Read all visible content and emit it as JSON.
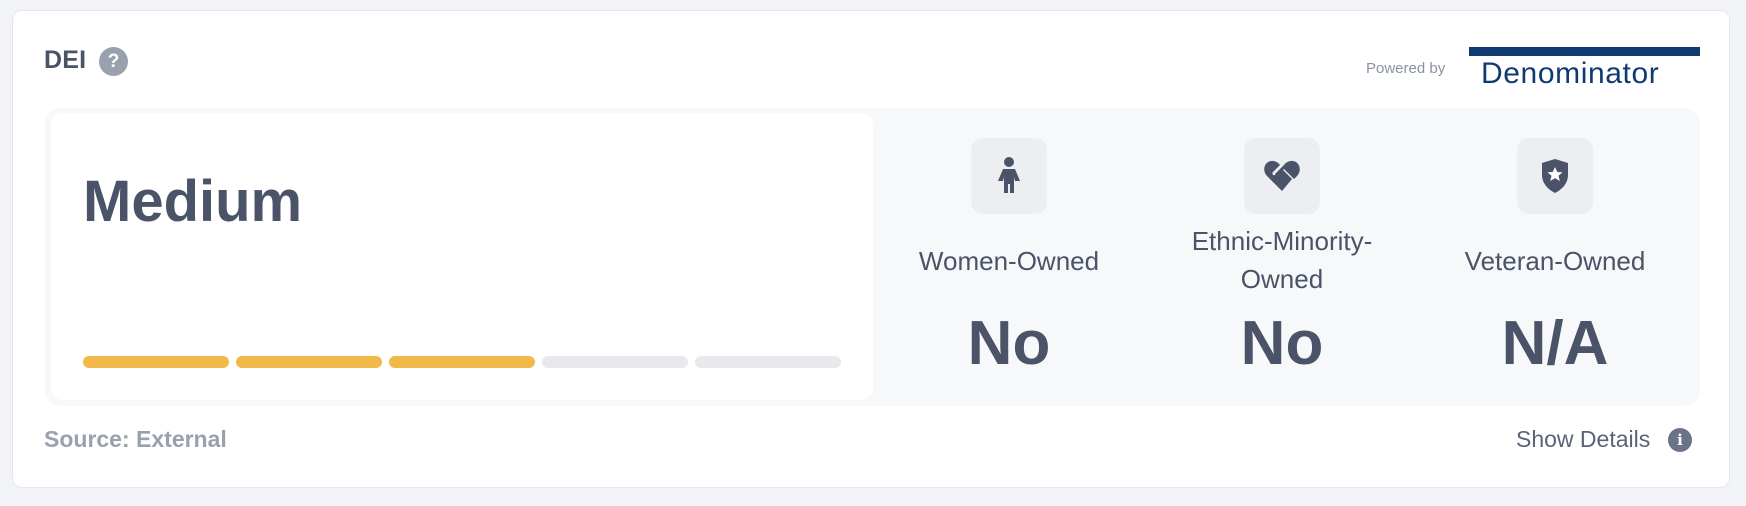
{
  "header": {
    "title": "DEI",
    "help_icon": "question-circle-icon",
    "powered_by": "Powered by",
    "brand": "Denominator",
    "brand_color": "#0f3a72"
  },
  "rating": {
    "label": "Medium",
    "level": 3,
    "max": 5,
    "active_color": "#f3b84a",
    "inactive_color": "#e8e9ec"
  },
  "attributes": [
    {
      "icon": "woman-icon",
      "label_line1": "Women-Owned",
      "label_line2": "",
      "value": "No"
    },
    {
      "icon": "heart-handshake-icon",
      "label_line1": "Ethnic-Minority-",
      "label_line2": "Owned",
      "value": "No"
    },
    {
      "icon": "shield-star-icon",
      "label_line1": "Veteran-Owned",
      "label_line2": "",
      "value": "N/A"
    }
  ],
  "footer": {
    "source": "Source: External",
    "details_label": "Show Details",
    "details_icon": "info-icon"
  }
}
